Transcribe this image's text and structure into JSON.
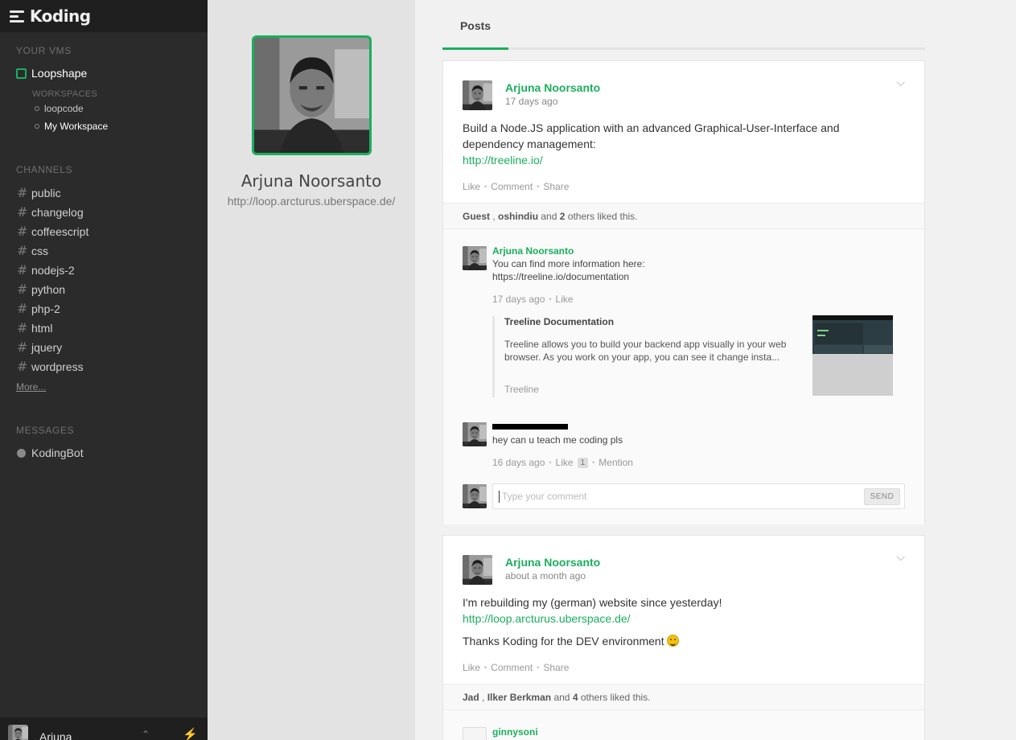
{
  "app": {
    "logo": "Koding"
  },
  "sidebar": {
    "vms_heading": "YOUR VMS",
    "vm": {
      "name": "Loopshape",
      "status_color": "#1aaf5d"
    },
    "workspaces_heading": "WORKSPACES",
    "workspaces": [
      {
        "label": "loopcode",
        "active": false
      },
      {
        "label": "My Workspace",
        "active": true
      }
    ],
    "channels_heading": "CHANNELS",
    "channels": [
      {
        "label": "public"
      },
      {
        "label": "changelog"
      },
      {
        "label": "coffeescript"
      },
      {
        "label": "css"
      },
      {
        "label": "nodejs-2"
      },
      {
        "label": "python"
      },
      {
        "label": "php-2"
      },
      {
        "label": "html"
      },
      {
        "label": "jquery"
      },
      {
        "label": "wordpress"
      }
    ],
    "more_label": "More...",
    "messages_heading": "MESSAGES",
    "messages": [
      {
        "label": "KodingBot"
      }
    ],
    "user": {
      "name": "Arjuna"
    }
  },
  "profile": {
    "name": "Arjuna Noorsanto",
    "url": "http://loop.arcturus.uberspace.de/"
  },
  "feed": {
    "tab_label": "Posts",
    "posts": [
      {
        "author": "Arjuna Noorsanto",
        "time": "17 days ago",
        "body_line1": "Build a Node.JS application with an advanced Graphical-User-Interface and",
        "body_line2": "dependency management:",
        "link": "http://treeline.io/",
        "actions": {
          "like": "Like",
          "comment": "Comment",
          "share": "Share"
        },
        "likes": {
          "user1": "Guest",
          "user2": "oshindiu",
          "connector": "and",
          "count": "2",
          "suffix": "others liked this."
        },
        "comments": [
          {
            "author": "Arjuna Noorsanto",
            "text": "You can find more information here:",
            "link": "https://treeline.io/documentation",
            "time": "17 days ago",
            "like": "Like",
            "embed": {
              "title": "Treeline Documentation",
              "description": "Treeline allows you to build your backend app visually in your web browser. As you work on your app, you can see it change insta...",
              "host": "Treeline"
            }
          },
          {
            "text": "hey can u teach me coding pls",
            "time": "16 days ago",
            "like": "Like",
            "like_count": "1",
            "mention": "Mention"
          }
        ],
        "comment_input": {
          "placeholder": "Type your comment",
          "send": "SEND"
        }
      },
      {
        "author": "Arjuna Noorsanto",
        "time": "about a month ago",
        "body_line1": "I'm rebuilding my (german) website since yesterday!",
        "link": "http://loop.arcturus.uberspace.de/",
        "body_line3": "Thanks Koding for the DEV environment",
        "actions": {
          "like": "Like",
          "comment": "Comment",
          "share": "Share"
        },
        "likes": {
          "user1": "Jad",
          "user2": "Ilker Berkman",
          "connector": "and",
          "count": "4",
          "suffix": "others liked this."
        },
        "comments": [
          {
            "author": "ginnysoni"
          }
        ]
      }
    ]
  },
  "colors": {
    "accent": "#1aaf5d",
    "sidebar_bg": "#2b2b2b",
    "profile_bg": "#e3e3e3"
  }
}
